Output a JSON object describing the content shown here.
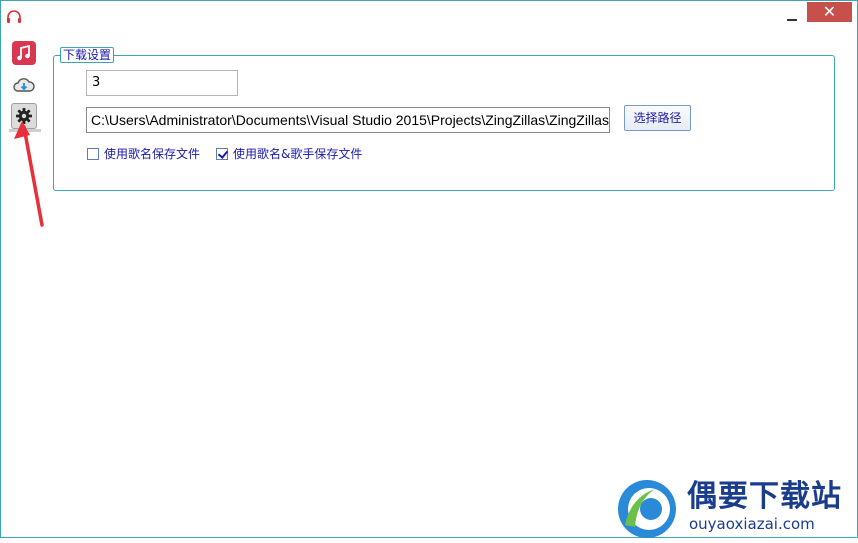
{
  "window": {
    "close_glyph": "✕",
    "app_icon": "headphones-icon"
  },
  "sidebar": {
    "items": [
      {
        "name": "music-icon",
        "active": false
      },
      {
        "name": "cloud-download-icon",
        "active": false
      },
      {
        "name": "gear-icon",
        "active": true
      }
    ]
  },
  "download_settings": {
    "group_title": "下载设置",
    "thread_count_value": "3",
    "save_path_value": "C:\\Users\\Administrator\\Documents\\Visual Studio 2015\\Projects\\ZingZillas\\ZingZillas\\",
    "browse_label": "选择路径",
    "options": [
      {
        "label": "使用歌名保存文件",
        "checked": false
      },
      {
        "label": "使用歌名&歌手保存文件",
        "checked": true
      }
    ]
  },
  "watermark": {
    "title": "偶要下载站",
    "url": "ouyaoxiazai.com"
  },
  "colors": {
    "accent": "#3aa5b5",
    "label_text": "#1a1ab0",
    "close_bg": "#c7504a",
    "annotation_arrow": "#e8303a"
  }
}
